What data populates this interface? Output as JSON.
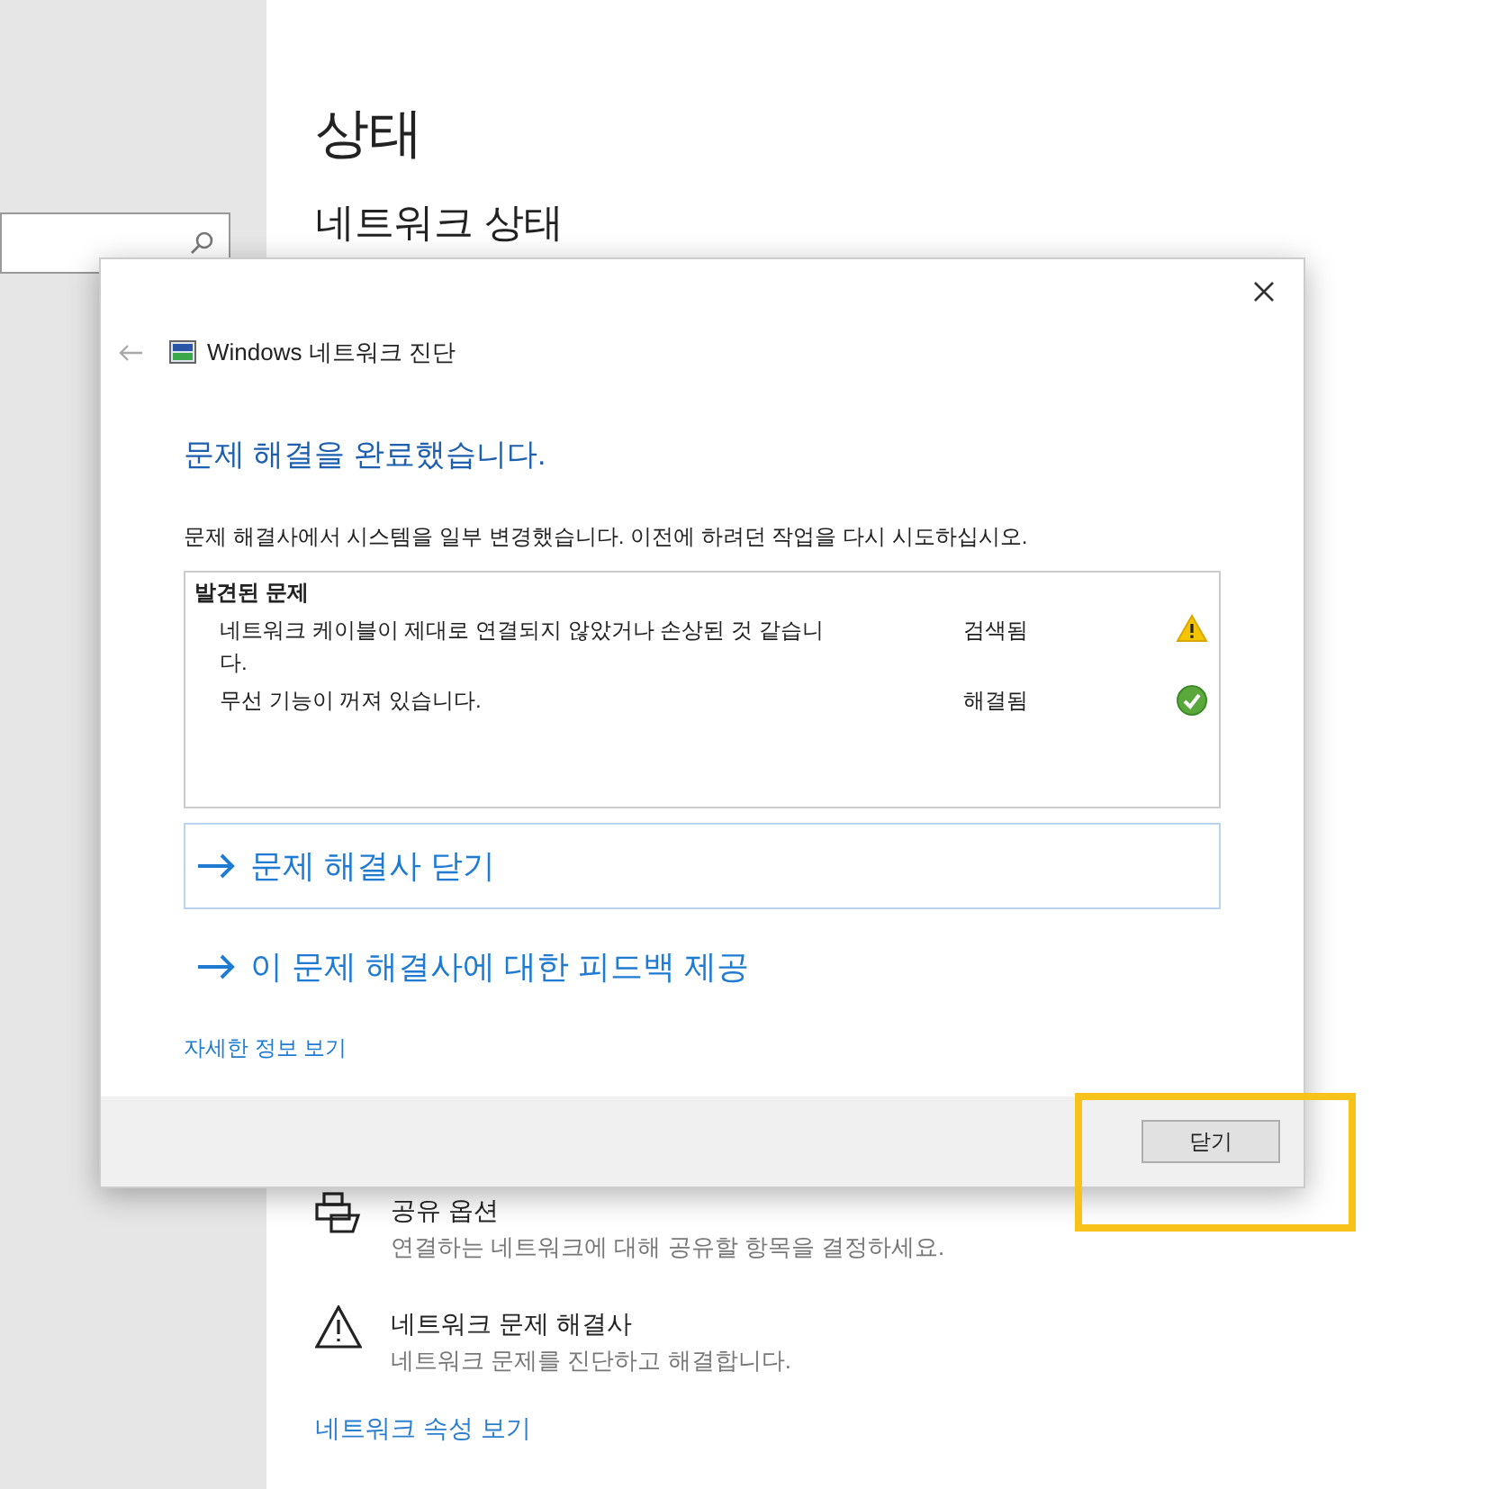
{
  "page": {
    "title": "상태",
    "subtitle": "네트워크 상태"
  },
  "settings_items": [
    {
      "kind": "sharing",
      "title": "공유 옵션",
      "description": "연결하는 네트워크에 대해 공유할 항목을 결정하세요."
    },
    {
      "kind": "troubleshooter",
      "title": "네트워크 문제 해결사",
      "description": "네트워크 문제를 진단하고 해결합니다."
    }
  ],
  "properties_link": "네트워크 속성 보기",
  "dialog": {
    "title": "Windows 네트워크 진단",
    "heading": "문제 해결을 완료했습니다.",
    "message": "문제 해결사에서 시스템을 일부 변경했습니다. 이전에 하려던 작업을 다시 시도하십시오.",
    "problems": {
      "heading": "발견된 문제",
      "rows": [
        {
          "kind": "warning",
          "text": "네트워크 케이블이 제대로 연결되지 않았거나 손상된 것 같습니다.",
          "status": "검색됨"
        },
        {
          "kind": "fixed",
          "text": "무선 기능이 꺼져 있습니다.",
          "status": "해결됨"
        }
      ]
    },
    "actions": [
      {
        "label": "문제 해결사 닫기",
        "selected": true
      },
      {
        "label": "이 문제 해결사에 대한 피드백 제공",
        "selected": false
      }
    ],
    "details_link": "자세한 정보 보기",
    "close_button": "닫기"
  }
}
